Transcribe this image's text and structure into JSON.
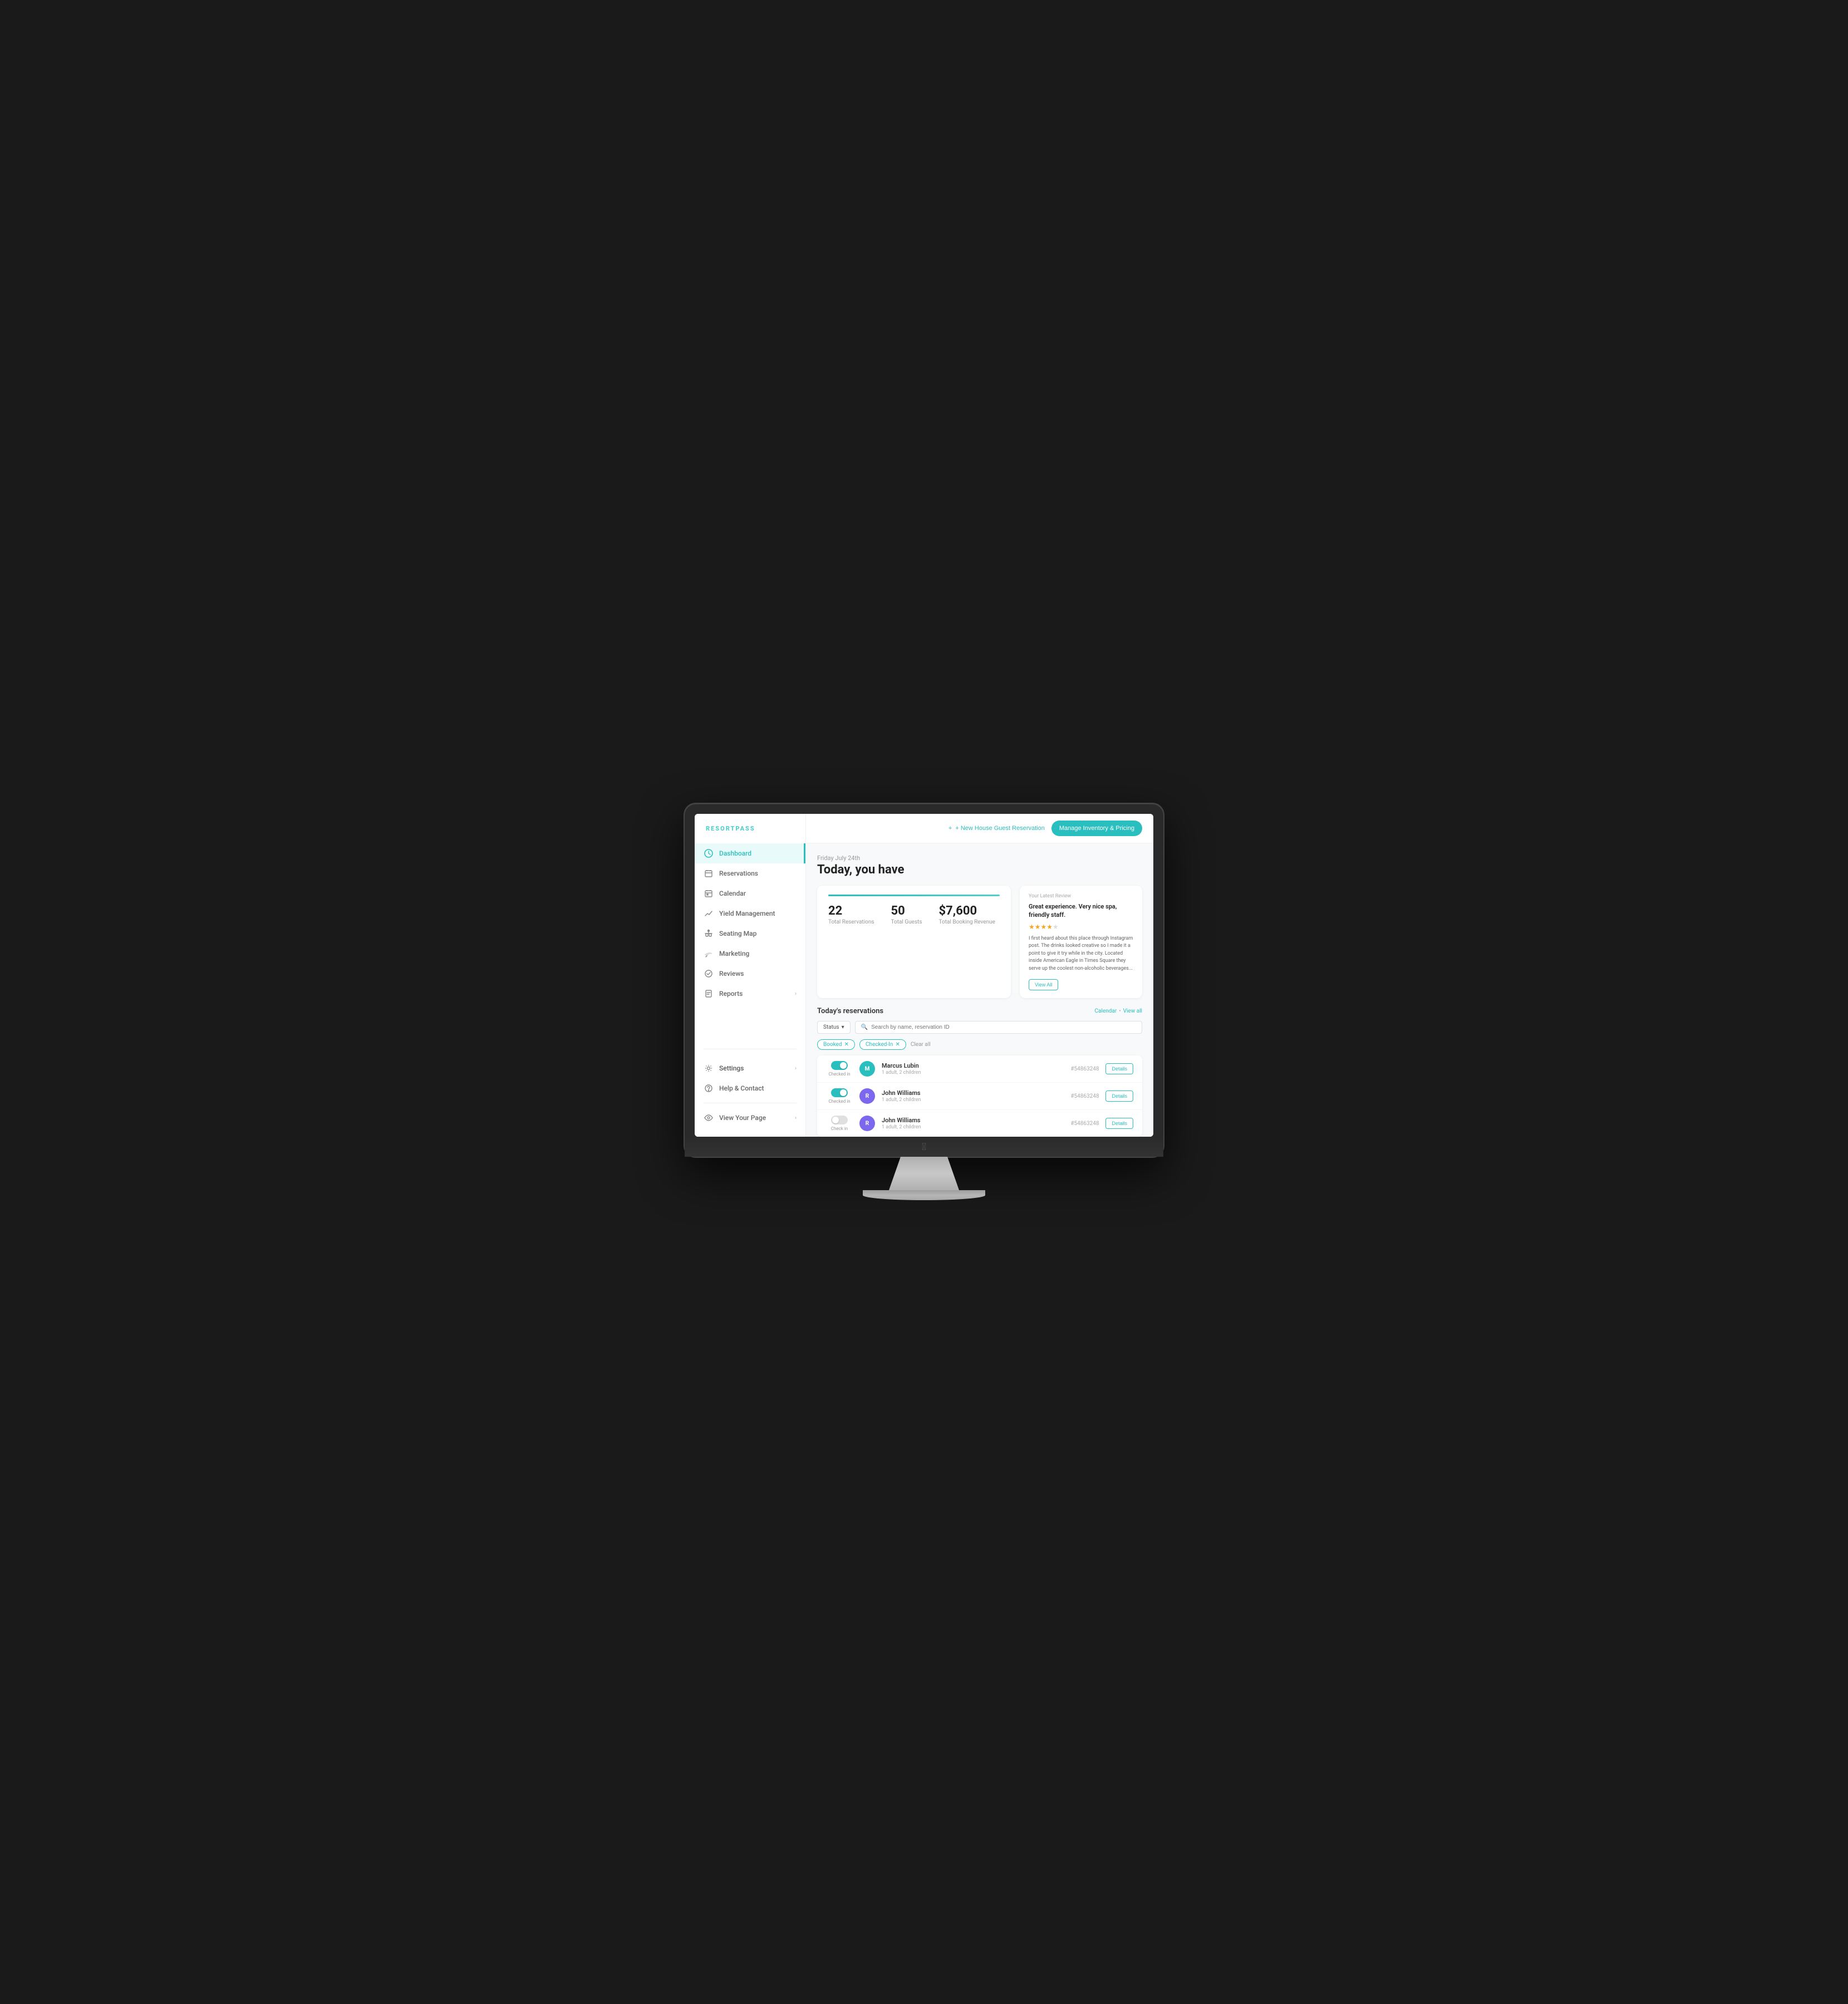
{
  "app": {
    "logo": "RESORTPASS"
  },
  "sidebar": {
    "items": [
      {
        "id": "dashboard",
        "label": "Dashboard",
        "icon": "dashboard",
        "active": true
      },
      {
        "id": "reservations",
        "label": "Reservations",
        "icon": "reservations",
        "active": false
      },
      {
        "id": "calendar",
        "label": "Calendar",
        "icon": "calendar",
        "active": false
      },
      {
        "id": "yield-management",
        "label": "Yield Management",
        "icon": "yield",
        "active": false
      },
      {
        "id": "seating-map",
        "label": "Seating Map",
        "icon": "seating",
        "active": false
      },
      {
        "id": "marketing",
        "label": "Marketing",
        "icon": "marketing",
        "active": false
      },
      {
        "id": "reviews",
        "label": "Reviews",
        "icon": "reviews",
        "active": false
      },
      {
        "id": "reports",
        "label": "Reports",
        "icon": "reports",
        "active": false
      }
    ],
    "settings": {
      "label": "Settings",
      "arrow": "›"
    },
    "help": {
      "label": "Help & Contact"
    },
    "view_your_page": {
      "label": "View Your Page",
      "arrow": "›"
    }
  },
  "topbar": {
    "new_reservation_label": "+ New House Guest Reservation",
    "manage_inventory_label": "Manage Inventory & Pricing"
  },
  "dashboard": {
    "date_label": "Friday July 24th",
    "heading": "Today, you have",
    "stats": {
      "total_reservations_value": "22",
      "total_reservations_label": "Total Reservations",
      "total_guests_value": "50",
      "total_guests_label": "Total Guests",
      "total_revenue_value": "$7,600",
      "total_revenue_label": "Total Booking Revenue"
    },
    "review": {
      "section_label": "Your Latest Review",
      "title": "Great experience. Very nice spa, friendly staff.",
      "stars": 4,
      "max_stars": 5,
      "body": "I first heard about this place through Instagram post. The drinks looked creative so I made it a point to give it try while in the city. Located inside American Eagle in Times Square they serve up the coolest non-alcoholic beverages...",
      "view_all_label": "View All"
    },
    "reservations_section": {
      "title": "Today's reservations",
      "calendar_link": "Calendar",
      "separator": "•",
      "view_all_link": "View all",
      "status_dropdown_label": "Status",
      "search_placeholder": "Search by name, reservation ID",
      "filters": [
        {
          "id": "booked",
          "label": "Booked"
        },
        {
          "id": "checked-in",
          "label": "Checked-In"
        }
      ],
      "clear_all_label": "Clear all",
      "reservations": [
        {
          "id": "res-1",
          "toggle_state": "on",
          "toggle_label": "Checked in",
          "avatar_initials": "M",
          "avatar_color": "teal",
          "guest_name": "Marcus Lubin",
          "guest_details": "1 adult, 2 children",
          "reservation_id": "#54863248",
          "details_label": "Details"
        },
        {
          "id": "res-2",
          "toggle_state": "on",
          "toggle_label": "Checked in",
          "avatar_initials": "R",
          "avatar_color": "blue",
          "guest_name": "John Williams",
          "guest_details": "1 adult, 2 children",
          "reservation_id": "#54863248",
          "details_label": "Details"
        },
        {
          "id": "res-3",
          "toggle_state": "off",
          "toggle_label": "Check in",
          "avatar_initials": "R",
          "avatar_color": "blue",
          "guest_name": "John Williams",
          "guest_details": "1 adult, 2 children",
          "reservation_id": "#54863248",
          "details_label": "Details"
        }
      ]
    }
  }
}
